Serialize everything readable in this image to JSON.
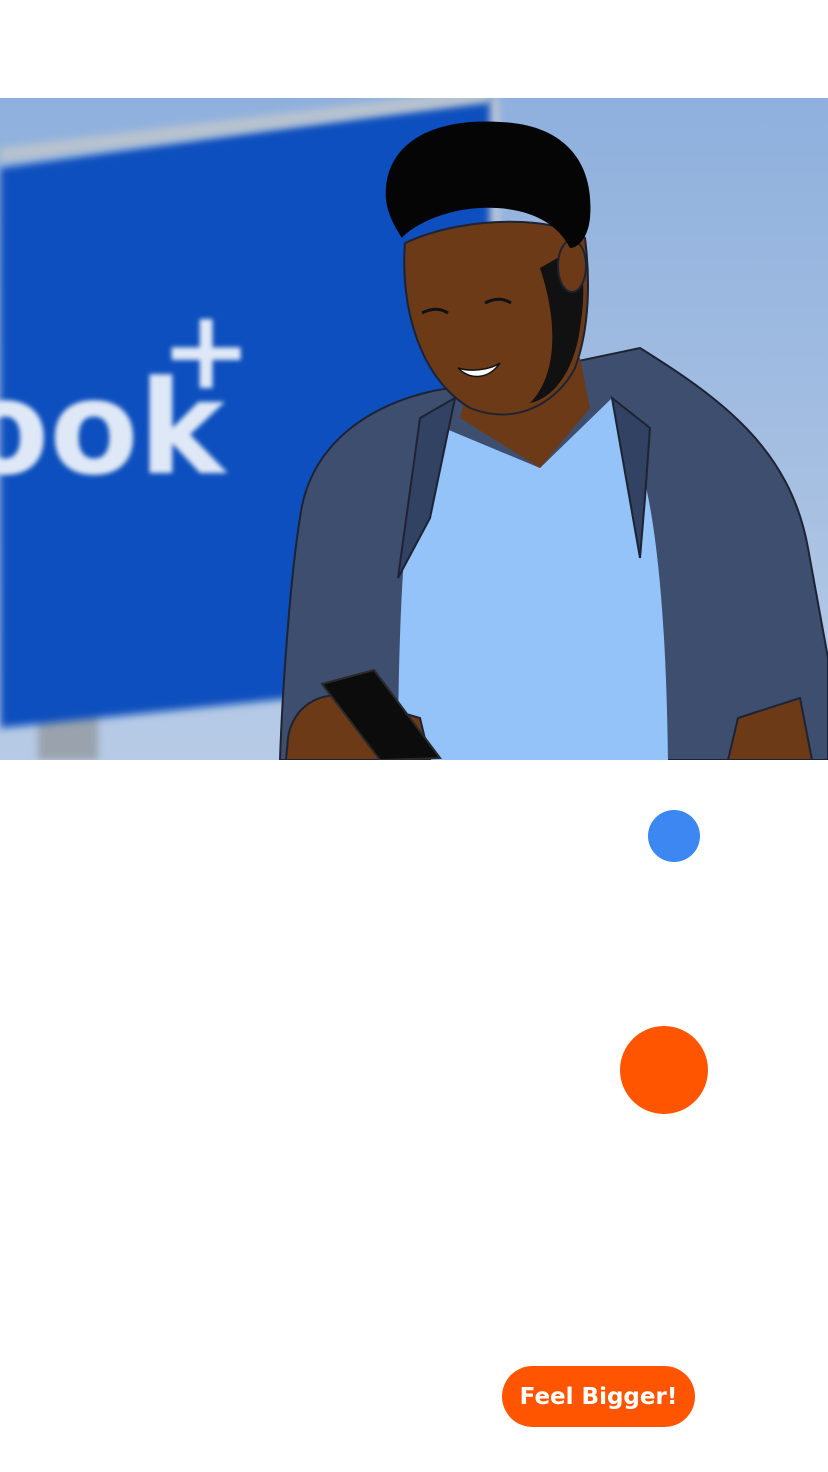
{
  "hero": {
    "sign_text": "ook",
    "sign_plus": "+",
    "illustration": "man-smiling-at-phone"
  },
  "indicators": {
    "blue_dot_color": "#3c87f2",
    "orange_dot_color": "#ff5500"
  },
  "cta": {
    "label": "Feel Bigger!",
    "color": "#ff5500"
  }
}
